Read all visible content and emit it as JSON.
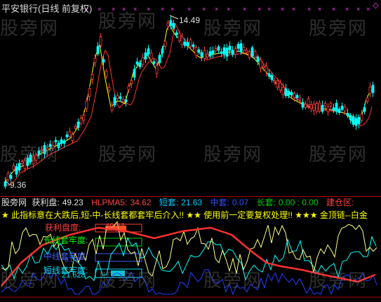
{
  "title": "平安银行(日线 前复权)",
  "high_label": "14.49",
  "low_label": "9.36",
  "watermark": "股旁网",
  "indicator": {
    "name": "股旁网",
    "items": [
      {
        "label": "获利盘:",
        "value": "49.23",
        "color": "#e0e0e0"
      },
      {
        "label": "HLPMA5:",
        "value": "34.62",
        "color": "#ff4040"
      },
      {
        "label": "短套:",
        "value": "21.63",
        "color": "#00c8ff"
      },
      {
        "label": "中套:",
        "value": "0.07",
        "color": "#3050ff"
      },
      {
        "label": "长套:",
        "value": "0.00 : 0.00",
        "color": "#00d000"
      },
      {
        "label": "建仓区:",
        "value": "",
        "color": "#ff4040"
      }
    ]
  },
  "notice": "★ 此指标意在大跌后,短-中-长线套都套牢后介入!! ★★ 使用前一定要复权处理!! ★★★ 金顶链--白金",
  "labels": {
    "profit": "获利盘度:",
    "profit_val": "49.23",
    "long": "长线套牢度:",
    "mid": "中线套牢度:",
    "mid_val": "0.07",
    "short": "短线套牢度:",
    "short_val": "21.628"
  },
  "colors": {
    "up": "#ff4040",
    "down": "#00ffff",
    "ma_short": "#ffff00",
    "ma_long": "#ff3030",
    "profit_line": "#e8e8e8",
    "short_line": "#ffff80",
    "mid_line": "#2040ff",
    "long_line": "#00ffff"
  },
  "icons": {
    "corner": "diamond-icon",
    "marker": "x-mark-icon"
  }
}
